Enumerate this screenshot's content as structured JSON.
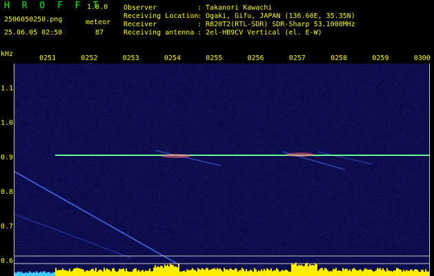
{
  "app": {
    "title": "H R O F F T",
    "version": "1.0.0"
  },
  "file": {
    "name": "2506050250.png",
    "datetime": "25.06.05 02:50",
    "category_label": "meteor",
    "count": "87"
  },
  "station": {
    "rows": [
      {
        "label": "Observer",
        "value": ": Takanori Kawachi"
      },
      {
        "label": "Receiving Location",
        "value": ": Ogaki, Gifu, JAPAN (136.60E, 35.35N)"
      },
      {
        "label": "Receiver",
        "value": ": R820T2(RTL-SDR) SDR-Sharp 53.1000MHz"
      },
      {
        "label": "Receiving antenna",
        "value": ": 2el-HB9CV Vertical (el. E-W)"
      }
    ]
  },
  "axes": {
    "y_unit": "kHz",
    "y_ticks": [
      "1.1",
      "1.0",
      "0.9",
      "0.8",
      "0.7",
      "0.6"
    ],
    "x_ticks": [
      "0251",
      "0252",
      "0253",
      "0254",
      "0255",
      "0256",
      "0257",
      "0258",
      "0259",
      "0300"
    ]
  },
  "colors": {
    "background": "#000000",
    "spectrogram_bg": "#0a0a4a",
    "carrier": "#40ff80",
    "meteor_trace": "#5070ff",
    "power_bar": "#ffee00",
    "title_green": "#00ff00",
    "label_yellow": "#ffff00"
  }
}
